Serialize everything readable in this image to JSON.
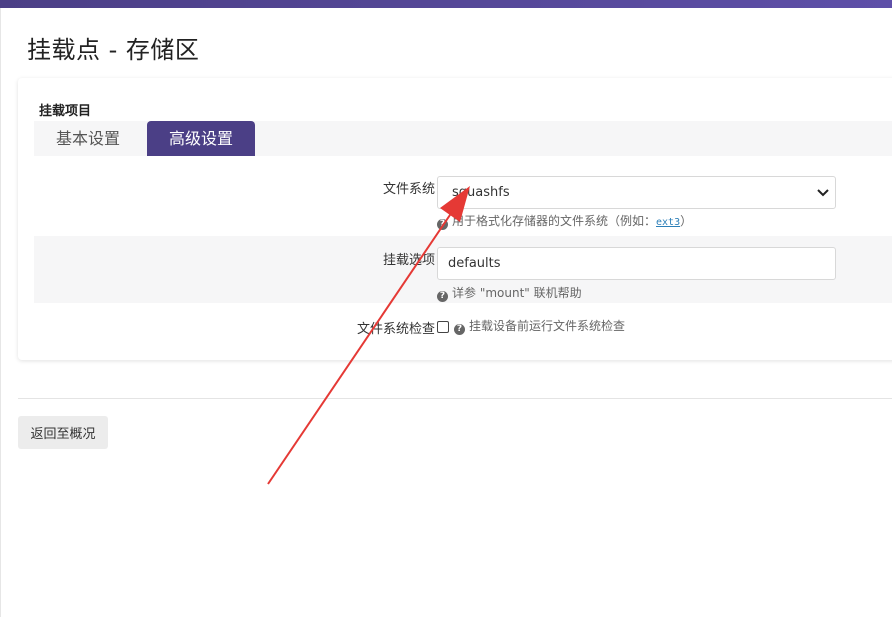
{
  "page": {
    "title": "挂载点 - 存储区"
  },
  "section": {
    "label": "挂载项目"
  },
  "tabs": [
    {
      "label": "基本设置",
      "active": false
    },
    {
      "label": "高级设置",
      "active": true
    }
  ],
  "fields": {
    "filesystem": {
      "label": "文件系统",
      "value": "squashfs",
      "help_prefix": "用于格式化存储器的文件系统（例如：",
      "help_link": "ext3",
      "help_suffix": "）"
    },
    "mount_options": {
      "label": "挂载选项",
      "value": "defaults",
      "help": "详参 \"mount\" 联机帮助"
    },
    "fs_check": {
      "label": "文件系统检查",
      "checked": false,
      "help": "挂载设备前运行文件系统检查"
    }
  },
  "actions": {
    "back_label": "返回至概况"
  },
  "annotation": {
    "color": "#e53935",
    "icon": "red-arrow-annotation"
  },
  "colors": {
    "accent": "#4b3f86",
    "link": "#2c7fb8"
  }
}
